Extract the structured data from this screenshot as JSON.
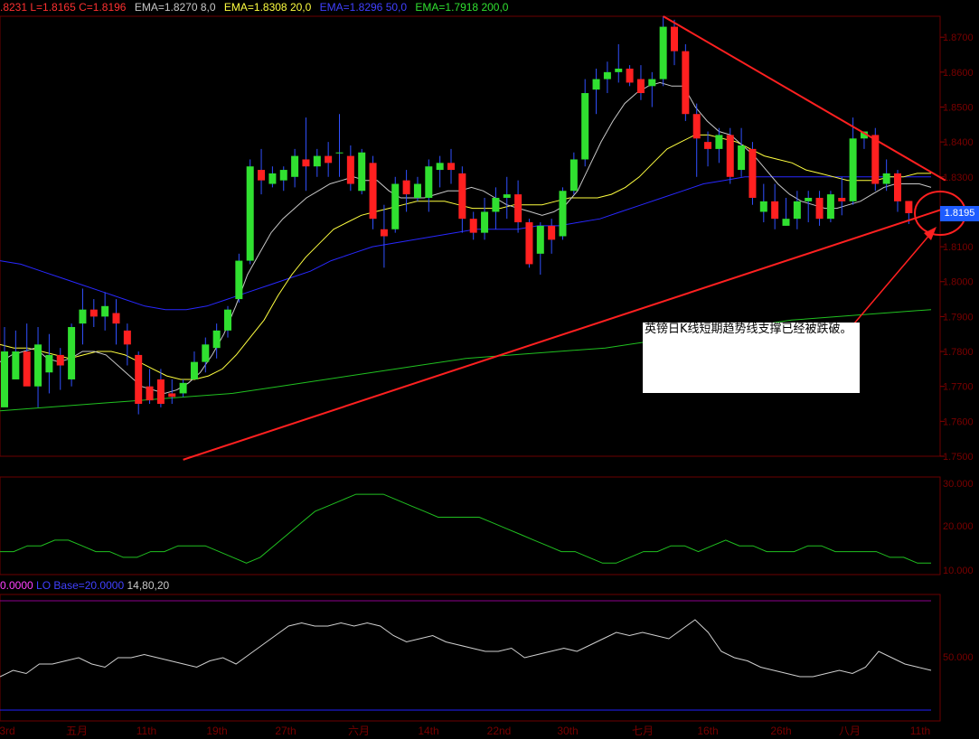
{
  "header": {
    "ohlc": ".8231 L=1.8165 C=1.8196",
    "ema1": "EMA=1.8270  8,0",
    "ema2": "EMA=1.8308  20,0",
    "ema3": "EMA=1.8296  50,0",
    "ema4": "EMA=1.7918  200,0"
  },
  "indicator_header": {
    "left": "0.0000",
    "middle": "LO Base=20.0000",
    "right": "14,80,20"
  },
  "annotation": "英镑日K线短期趋势线支撑已经被跌破。",
  "last_price": "1.8195",
  "colors": {
    "up": "#30e030",
    "down": "#ff2020",
    "trend": "#ff2020",
    "ema8": "#c8c8c8",
    "ema20": "#ffff40",
    "ema50": "#2828ff",
    "ema200": "#20c020",
    "axis": "#8b0000",
    "osc": "#20c020",
    "osc2": "#d0d0d0",
    "bound": "#2020ff"
  },
  "chart_data": [
    {
      "type": "candlestick",
      "title": "",
      "ylim": [
        1.75,
        1.876
      ],
      "y_ticks": [
        "1.8700",
        "1.8600",
        "1.8500",
        "1.8400",
        "1.8300",
        "1.8200",
        "1.8100",
        "1.8000",
        "1.7900",
        "1.7800",
        "1.7700",
        "1.7600",
        "1.7500"
      ],
      "x_ticks": [
        "3rd",
        "五月",
        "11th",
        "19th",
        "27th",
        "六月",
        "14th",
        "22nd",
        "30th",
        "七月",
        "16th",
        "26th",
        "八月",
        "11th"
      ],
      "candles_ohlc": [
        [
          1.764,
          1.787,
          1.78,
          1.772
        ],
        [
          1.772,
          1.786,
          1.78,
          1.774
        ],
        [
          1.78,
          1.788,
          1.77,
          1.774
        ],
        [
          1.77,
          1.787,
          1.782,
          1.764
        ],
        [
          1.774,
          1.785,
          1.779,
          1.768
        ],
        [
          1.779,
          1.781,
          1.776,
          1.769
        ],
        [
          1.772,
          1.788,
          1.787,
          1.77
        ],
        [
          1.788,
          1.798,
          1.792,
          1.782
        ],
        [
          1.792,
          1.795,
          1.79,
          1.787
        ],
        [
          1.79,
          1.797,
          1.793,
          1.786
        ],
        [
          1.791,
          1.795,
          1.788,
          1.782
        ],
        [
          1.786,
          1.788,
          1.782,
          1.776
        ],
        [
          1.779,
          1.78,
          1.765,
          1.762
        ],
        [
          1.77,
          1.775,
          1.766,
          1.765
        ],
        [
          1.772,
          1.775,
          1.765,
          1.764
        ],
        [
          1.768,
          1.772,
          1.767,
          1.765
        ],
        [
          1.768,
          1.772,
          1.771,
          1.767
        ],
        [
          1.772,
          1.78,
          1.777,
          1.772
        ],
        [
          1.777,
          1.784,
          1.782,
          1.774
        ],
        [
          1.781,
          1.788,
          1.786,
          1.778
        ],
        [
          1.786,
          1.793,
          1.792,
          1.784
        ],
        [
          1.795,
          1.808,
          1.806,
          1.794
        ],
        [
          1.806,
          1.835,
          1.833,
          1.805
        ],
        [
          1.832,
          1.838,
          1.829,
          1.825
        ],
        [
          1.828,
          1.833,
          1.831,
          1.827
        ],
        [
          1.829,
          1.833,
          1.832,
          1.826
        ],
        [
          1.83,
          1.838,
          1.836,
          1.827
        ],
        [
          1.835,
          1.847,
          1.833,
          1.826
        ],
        [
          1.833,
          1.838,
          1.836,
          1.83
        ],
        [
          1.836,
          1.84,
          1.834,
          1.83
        ],
        [
          1.837,
          1.848,
          1.837,
          1.83
        ],
        [
          1.836,
          1.839,
          1.828,
          1.826
        ],
        [
          1.826,
          1.838,
          1.837,
          1.825
        ],
        [
          1.834,
          1.836,
          1.818,
          1.815
        ],
        [
          1.815,
          1.822,
          1.813,
          1.804
        ],
        [
          1.815,
          1.83,
          1.828,
          1.814
        ],
        [
          1.829,
          1.832,
          1.825,
          1.82
        ],
        [
          1.824,
          1.83,
          1.828,
          1.823
        ],
        [
          1.824,
          1.835,
          1.833,
          1.82
        ],
        [
          1.832,
          1.836,
          1.834,
          1.827
        ],
        [
          1.834,
          1.838,
          1.832,
          1.828
        ],
        [
          1.831,
          1.833,
          1.818,
          1.814
        ],
        [
          1.818,
          1.82,
          1.814,
          1.812
        ],
        [
          1.814,
          1.824,
          1.82,
          1.812
        ],
        [
          1.82,
          1.827,
          1.824,
          1.815
        ],
        [
          1.824,
          1.83,
          1.825,
          1.818
        ],
        [
          1.825,
          1.829,
          1.817,
          1.814
        ],
        [
          1.817,
          1.818,
          1.805,
          1.804
        ],
        [
          1.808,
          1.817,
          1.816,
          1.802
        ],
        [
          1.816,
          1.818,
          1.812,
          1.808
        ],
        [
          1.813,
          1.827,
          1.826,
          1.812
        ],
        [
          1.826,
          1.837,
          1.835,
          1.825
        ],
        [
          1.835,
          1.858,
          1.854,
          1.833
        ],
        [
          1.855,
          1.861,
          1.858,
          1.848
        ],
        [
          1.858,
          1.863,
          1.86,
          1.854
        ],
        [
          1.86,
          1.868,
          1.861,
          1.857
        ],
        [
          1.861,
          1.862,
          1.857,
          1.856
        ],
        [
          1.858,
          1.862,
          1.854,
          1.852
        ],
        [
          1.856,
          1.86,
          1.858,
          1.85
        ],
        [
          1.858,
          1.876,
          1.873,
          1.856
        ],
        [
          1.873,
          1.875,
          1.866,
          1.862
        ],
        [
          1.866,
          1.868,
          1.848,
          1.846
        ],
        [
          1.848,
          1.851,
          1.841,
          1.83
        ],
        [
          1.84,
          1.843,
          1.838,
          1.833
        ],
        [
          1.838,
          1.844,
          1.842,
          1.834
        ],
        [
          1.842,
          1.844,
          1.83,
          1.828
        ],
        [
          1.832,
          1.844,
          1.839,
          1.83
        ],
        [
          1.838,
          1.84,
          1.824,
          1.822
        ],
        [
          1.82,
          1.828,
          1.823,
          1.817
        ],
        [
          1.823,
          1.828,
          1.818,
          1.815
        ],
        [
          1.816,
          1.824,
          1.818,
          1.816
        ],
        [
          1.818,
          1.826,
          1.823,
          1.815
        ],
        [
          1.823,
          1.826,
          1.824,
          1.817
        ],
        [
          1.824,
          1.826,
          1.818,
          1.816
        ],
        [
          1.818,
          1.826,
          1.825,
          1.817
        ],
        [
          1.824,
          1.83,
          1.823,
          1.819
        ],
        [
          1.823,
          1.847,
          1.841,
          1.822
        ],
        [
          1.841,
          1.843,
          1.843,
          1.838
        ],
        [
          1.842,
          1.844,
          1.828,
          1.826
        ],
        [
          1.828,
          1.835,
          1.831,
          1.826
        ],
        [
          1.831,
          1.832,
          1.823,
          1.82
        ],
        [
          1.8231,
          1.8231,
          1.8196,
          1.8165
        ]
      ],
      "ema8": [
        1.777,
        1.779,
        1.78,
        1.781,
        1.778,
        1.777,
        1.778,
        1.78,
        1.78,
        1.779,
        1.776,
        1.773,
        1.77,
        1.769,
        1.768,
        1.769,
        1.771,
        1.774,
        1.779,
        1.785,
        1.793,
        1.802,
        1.808,
        1.814,
        1.818,
        1.821,
        1.824,
        1.826,
        1.828,
        1.829,
        1.83,
        1.829,
        1.829,
        1.826,
        1.824,
        1.824,
        1.824,
        1.825,
        1.826,
        1.826,
        1.827,
        1.826,
        1.824,
        1.822,
        1.821,
        1.82,
        1.819,
        1.82,
        1.822,
        1.826,
        1.833,
        1.84,
        1.846,
        1.851,
        1.854,
        1.856,
        1.857,
        1.856,
        1.856,
        1.85,
        1.846,
        1.843,
        1.842,
        1.839,
        1.836,
        1.832,
        1.828,
        1.825,
        1.823,
        1.822,
        1.821,
        1.821,
        1.822,
        1.823,
        1.825,
        1.827,
        1.828,
        1.828,
        1.828,
        1.827
      ],
      "ema20": [
        1.782,
        1.781,
        1.781,
        1.78,
        1.779,
        1.778,
        1.779,
        1.78,
        1.78,
        1.779,
        1.777,
        1.775,
        1.773,
        1.772,
        1.772,
        1.773,
        1.775,
        1.779,
        1.784,
        1.789,
        1.796,
        1.802,
        1.807,
        1.811,
        1.815,
        1.817,
        1.819,
        1.82,
        1.821,
        1.822,
        1.823,
        1.823,
        1.823,
        1.822,
        1.821,
        1.821,
        1.821,
        1.822,
        1.822,
        1.822,
        1.823,
        1.824,
        1.824,
        1.824,
        1.825,
        1.827,
        1.83,
        1.834,
        1.838,
        1.84,
        1.842,
        1.842,
        1.841,
        1.84,
        1.838,
        1.836,
        1.835,
        1.834,
        1.832,
        1.831,
        1.83,
        1.829,
        1.829,
        1.829,
        1.83,
        1.83,
        1.831,
        1.831
      ],
      "ema50": [
        1.806,
        1.805,
        1.803,
        1.801,
        1.799,
        1.797,
        1.795,
        1.793,
        1.792,
        1.792,
        1.793,
        1.795,
        1.797,
        1.799,
        1.801,
        1.803,
        1.806,
        1.808,
        1.81,
        1.811,
        1.812,
        1.813,
        1.814,
        1.815,
        1.815,
        1.815,
        1.816,
        1.816,
        1.817,
        1.818,
        1.82,
        1.822,
        1.824,
        1.826,
        1.828,
        1.829,
        1.83,
        1.83,
        1.83,
        1.83,
        1.83,
        1.83,
        1.83,
        1.83,
        1.83,
        1.83
      ],
      "ema200": [
        1.763,
        1.764,
        1.765,
        1.766,
        1.767,
        1.768,
        1.77,
        1.772,
        1.774,
        1.776,
        1.778,
        1.779,
        1.78,
        1.781,
        1.783,
        1.785,
        1.787,
        1.789,
        1.79,
        1.791,
        1.792
      ],
      "trendlines": [
        {
          "from": [
            16,
            1.749
          ],
          "to": [
            82,
            1.821
          ]
        },
        {
          "from": [
            59,
            1.876
          ],
          "to": [
            82,
            1.829
          ]
        }
      ]
    },
    {
      "type": "line",
      "title": "",
      "ylim": [
        15,
        32
      ],
      "y_ticks": [
        "30.000",
        "20.000",
        "10.000"
      ],
      "values": [
        19,
        19,
        20,
        20,
        21,
        21,
        20,
        19,
        19,
        18,
        18,
        19,
        19,
        20,
        20,
        20,
        19,
        18,
        17,
        18,
        20,
        22,
        24,
        26,
        27,
        28,
        29,
        29,
        29,
        28,
        27,
        26,
        25,
        25,
        25,
        25,
        24,
        23,
        22,
        21,
        20,
        19,
        19,
        18,
        17,
        17,
        18,
        19,
        19,
        20,
        20,
        19,
        20,
        21,
        20,
        20,
        19,
        19,
        19,
        20,
        20,
        19,
        19,
        19,
        19,
        18,
        18,
        17,
        17
      ]
    },
    {
      "type": "line",
      "title": "",
      "ylim": [
        40,
        80
      ],
      "y_ticks": [
        "50.000"
      ],
      "upper_line": 80,
      "lower_line": 20,
      "values": [
        54,
        56,
        55,
        58,
        58,
        59,
        60,
        58,
        57,
        60,
        60,
        61,
        60,
        59,
        58,
        57,
        59,
        60,
        58,
        61,
        64,
        67,
        70,
        71,
        70,
        70,
        71,
        70,
        71,
        70,
        67,
        65,
        66,
        67,
        65,
        64,
        63,
        62,
        62,
        63,
        60,
        61,
        62,
        63,
        62,
        64,
        66,
        68,
        67,
        68,
        67,
        66,
        69,
        72,
        68,
        62,
        60,
        59,
        57,
        56,
        55,
        54,
        54,
        55,
        56,
        55,
        57,
        62,
        60,
        58,
        57,
        56
      ]
    }
  ]
}
